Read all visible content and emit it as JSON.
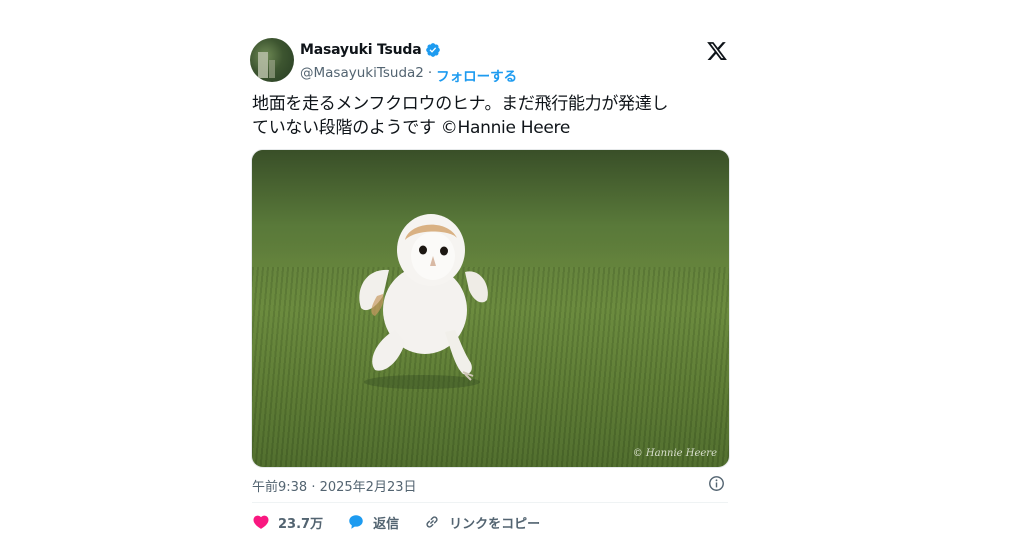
{
  "tweet": {
    "author": {
      "name": "Masayuki Tsuda",
      "handle": "@MasayukiTsuda2",
      "separator": "·",
      "follow_label": "フォローする",
      "verified": true
    },
    "text_lines": [
      "地面を走るメンフクロウのヒナ。まだ飛行能力が発達し",
      "ていない段階のようです ©Hannie Heere"
    ],
    "media": {
      "watermark": "© Hannie Heere"
    },
    "timestamp": "午前9:38 · 2025年2月23日",
    "actions": {
      "like_count": "23.7万",
      "reply_label": "返信",
      "copy_link_label": "リンクをコピー"
    }
  },
  "colors": {
    "accent": "#1d9bf0",
    "like": "#f91880",
    "text": "#0f1419",
    "muted": "#536471"
  },
  "icons": [
    "verified-badge-icon",
    "x-logo-icon",
    "info-icon",
    "heart-icon",
    "reply-bubble-icon",
    "link-icon"
  ]
}
